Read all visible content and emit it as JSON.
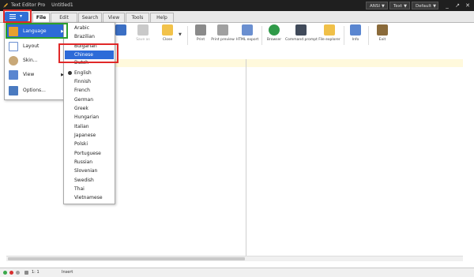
{
  "window": {
    "app_name": "Text Editor Pro",
    "doc_name": "Untitled1",
    "encoding_btn": "ANSI",
    "mode_btn": "Text",
    "theme_btn": "Default"
  },
  "tabs": [
    "File",
    "Edit",
    "Search",
    "View",
    "Tools",
    "Help"
  ],
  "toolbar": [
    {
      "label": "",
      "icon": "save-icon",
      "color": "#3b6fc4"
    },
    {
      "label": "Save as",
      "icon": "save-as-icon",
      "color": "#c9c9c9",
      "disabled": true
    },
    {
      "label": "Close",
      "icon": "folder-icon",
      "color": "#f2c24a"
    },
    {
      "label": "Print",
      "icon": "printer-icon",
      "color": "#8a8a8a"
    },
    {
      "label": "Print preview",
      "icon": "print-preview-icon",
      "color": "#a0a0a0"
    },
    {
      "label": "HTML export",
      "icon": "html-export-icon",
      "color": "#6a8fd0"
    },
    {
      "label": "Browser",
      "icon": "browser-globe-icon",
      "color": "#2f9a48"
    },
    {
      "label": "Command prompt",
      "icon": "command-prompt-icon",
      "color": "#404a5a"
    },
    {
      "label": "File explorer",
      "icon": "file-explorer-icon",
      "color": "#f0c048"
    },
    {
      "label": "Info",
      "icon": "info-icon",
      "color": "#5a86d0"
    },
    {
      "label": "Exit",
      "icon": "exit-door-icon",
      "color": "#8a6a3a"
    }
  ],
  "main_menu": [
    {
      "label": "Language",
      "icon": "language-icon",
      "has_submenu": true,
      "highlighted": true
    },
    {
      "label": "Layout",
      "icon": "layout-icon",
      "has_submenu": false
    },
    {
      "label": "Skin...",
      "icon": "skin-icon",
      "has_submenu": false
    },
    {
      "label": "View",
      "icon": "view-icon",
      "has_submenu": true
    },
    {
      "label": "Options...",
      "icon": "options-icon",
      "has_submenu": false
    }
  ],
  "languages": [
    {
      "label": "Arabic"
    },
    {
      "label": "Brazilian"
    },
    {
      "label": "Bulgarian"
    },
    {
      "label": "Chinese",
      "highlighted": true
    },
    {
      "label": "Dutch"
    },
    {
      "label": "English",
      "selected": true
    },
    {
      "label": "Finnish"
    },
    {
      "label": "French"
    },
    {
      "label": "German"
    },
    {
      "label": "Greek"
    },
    {
      "label": "Hungarian"
    },
    {
      "label": "Italian"
    },
    {
      "label": "Japanese"
    },
    {
      "label": "Polski"
    },
    {
      "label": "Portuguese"
    },
    {
      "label": "Russian"
    },
    {
      "label": "Slovenian"
    },
    {
      "label": "Swedish"
    },
    {
      "label": "Thai"
    },
    {
      "label": "Vietnamese"
    }
  ],
  "status": {
    "position": "1: 1",
    "mode": "Insert"
  },
  "colors": {
    "accent": "#2d6bd8",
    "annotation_red": "#e02828",
    "annotation_green": "#2ca02c"
  }
}
